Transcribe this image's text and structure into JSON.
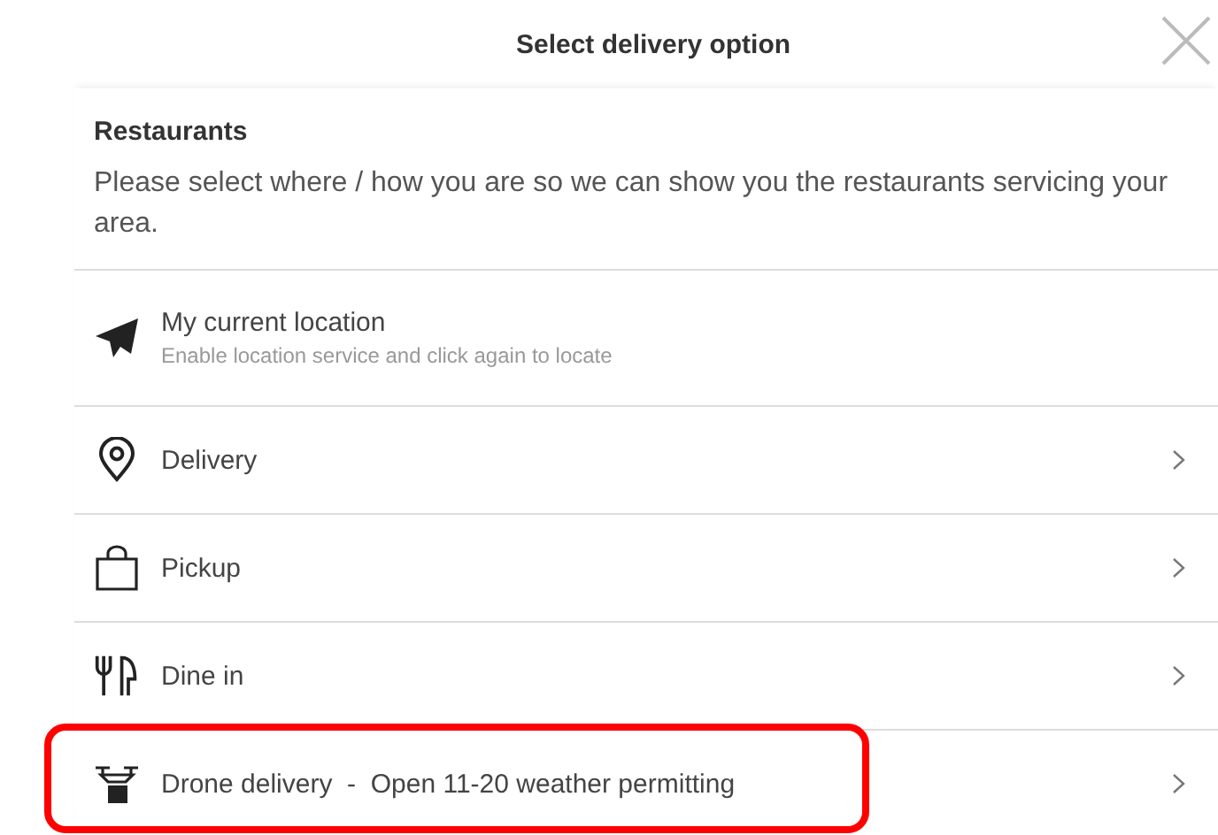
{
  "dialog": {
    "title": "Select delivery option"
  },
  "section": {
    "heading": "Restaurants",
    "description": "Please select where / how you are so we can show you the restaurants servicing your area."
  },
  "options": [
    {
      "kind": "plane",
      "label": "My current location",
      "subtitle": "Enable location service and click again to locate",
      "chevron": false,
      "highlighted": false
    },
    {
      "kind": "pin",
      "label": "Delivery",
      "chevron": true,
      "highlighted": false
    },
    {
      "kind": "bag",
      "label": "Pickup",
      "chevron": true,
      "highlighted": false
    },
    {
      "kind": "cutlery",
      "label": "Dine in",
      "chevron": true,
      "highlighted": false
    },
    {
      "kind": "drone",
      "label": "Drone delivery  -  Open 11-20 weather permitting",
      "chevron": true,
      "highlighted": true
    }
  ]
}
